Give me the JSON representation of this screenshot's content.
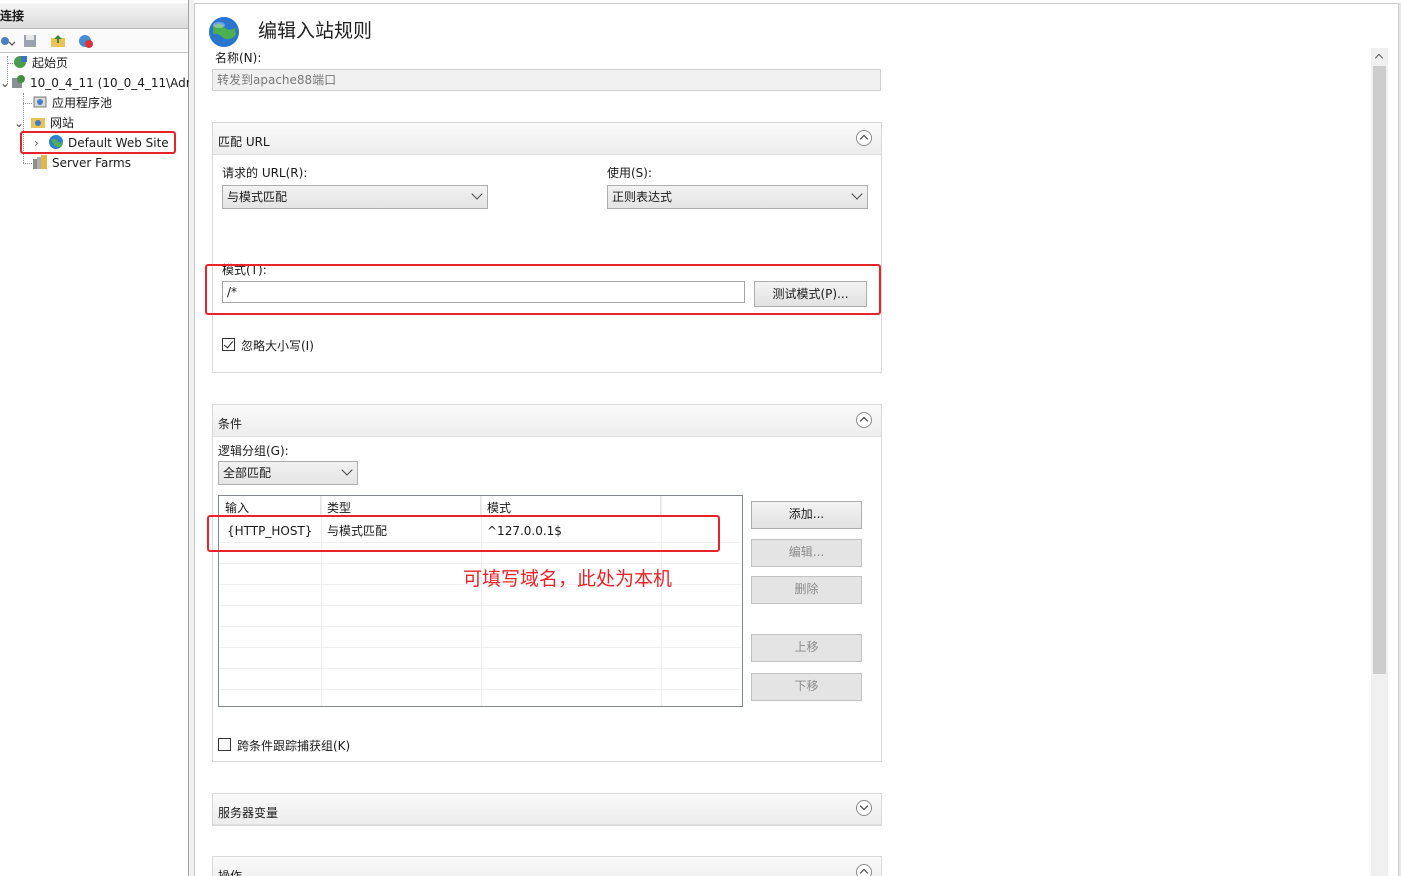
{
  "connections": {
    "header": "连接",
    "tree": [
      {
        "label": "起始页"
      },
      {
        "label": "10_0_4_11 (10_0_4_11\\Adm"
      },
      {
        "label": "应用程序池"
      },
      {
        "label": "网站"
      },
      {
        "label": "Default Web Site"
      },
      {
        "label": "Server Farms"
      }
    ]
  },
  "editor": {
    "title": "编辑入站规则",
    "name_label": "名称(N):",
    "name_value": "转发到apache88端口",
    "match_url": {
      "title": "匹配 URL",
      "requested_url_label": "请求的 URL(R):",
      "requested_url_value": "与模式匹配",
      "using_label": "使用(S):",
      "using_value": "正则表达式",
      "pattern_label": "模式(T):",
      "pattern_value": "/*",
      "test_button": "测试模式(P)...",
      "ignore_case_label": "忽略大小写(I)",
      "ignore_case_checked": true
    },
    "conditions": {
      "title": "条件",
      "logical_grouping_label": "逻辑分组(G):",
      "logical_grouping_value": "全部匹配",
      "columns": [
        "输入",
        "类型",
        "模式"
      ],
      "rows": [
        {
          "input": "{HTTP_HOST}",
          "type": "与模式匹配",
          "pattern": "^127.0.0.1$"
        }
      ],
      "buttons": {
        "add": "添加...",
        "edit": "编辑...",
        "remove": "删除",
        "move_up": "上移",
        "move_down": "下移"
      },
      "track_groups_label": "跨条件跟踪捕获组(K)",
      "track_groups_checked": false
    },
    "server_variables": {
      "title": "服务器变量"
    },
    "action": {
      "title": "操作"
    }
  },
  "annotation": {
    "text": "可填写域名，此处为本机",
    "color": "#e8242a"
  }
}
